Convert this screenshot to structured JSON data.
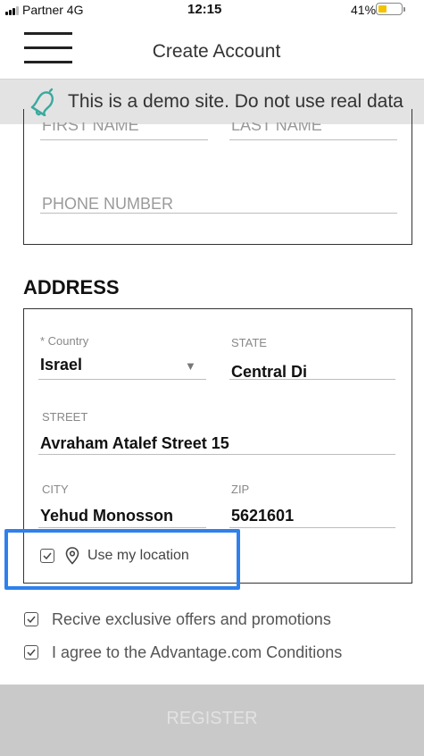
{
  "status_bar": {
    "carrier": "Partner 4G",
    "time": "12:15",
    "battery": "41%",
    "battery_level": 0.41,
    "battery_color": "#f2c400"
  },
  "header": {
    "title": "Create Account",
    "menu_icon": "hamburger-menu-icon"
  },
  "demo_banner": {
    "icon": "bell-icon",
    "text": "This is a demo site. Do not use real data"
  },
  "personal": {
    "first_name_label": "FIRST NAME",
    "last_name_label": "LAST NAME",
    "phone_label": "PHONE NUMBER"
  },
  "address": {
    "section_title": "ADDRESS",
    "country_label": "* Country",
    "country_value": "Israel",
    "state_label": "STATE",
    "state_value": "Central Di",
    "street_label": "STREET",
    "street_value": "Avraham Atalef Street 15",
    "city_label": "CITY",
    "city_value": "Yehud Monosson",
    "zip_label": "ZIP",
    "zip_value": "5621601",
    "use_location_label": "Use my location",
    "use_location_checked": true
  },
  "agreements": {
    "offers_label": "Recive exclusive offers and promotions",
    "offers_checked": true,
    "conditions_label": "I agree to the Advantage.com Conditions",
    "conditions_checked": true
  },
  "register_button": {
    "label": "REGISTER"
  },
  "colors": {
    "highlight": "#2f80ed",
    "banner_bg": "#e3e3e3",
    "bell": "#3aa99f",
    "register_bg": "#c9c9c9"
  }
}
